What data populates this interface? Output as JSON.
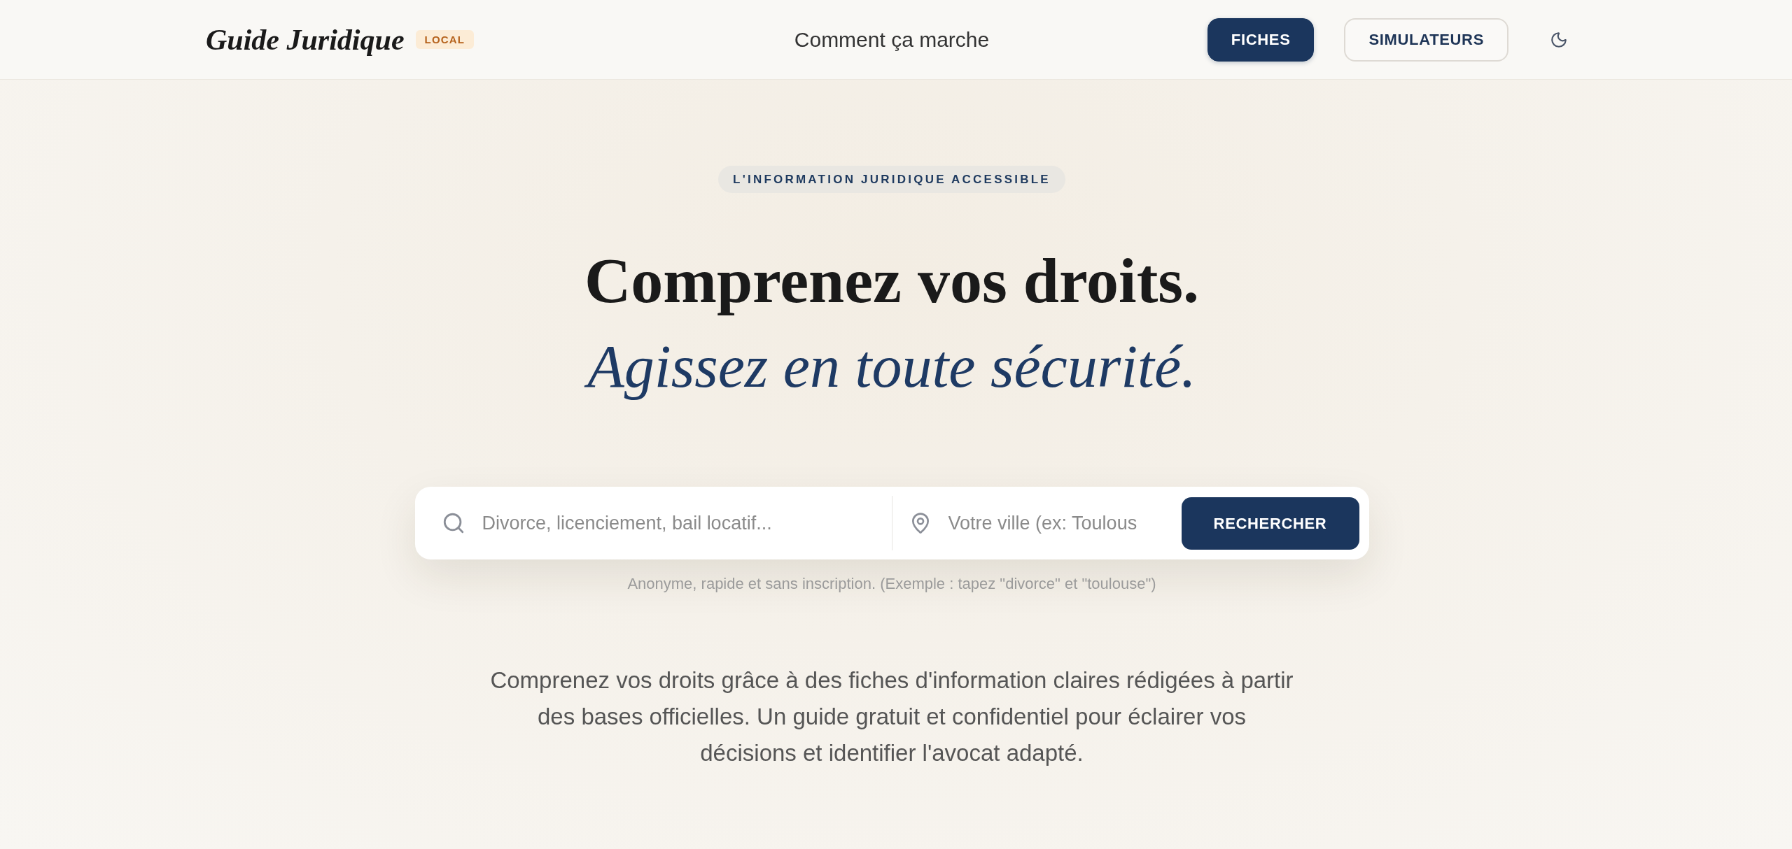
{
  "header": {
    "logo": "Guide Juridique",
    "logo_badge": "LOCAL",
    "nav_link": "Comment ça marche",
    "buttons": [
      {
        "label": "FICHES",
        "kind": "primary"
      },
      {
        "label": "SIMULATEURS",
        "kind": "secondary"
      }
    ]
  },
  "hero": {
    "eyebrow": "L'INFORMATION JURIDIQUE ACCESSIBLE",
    "title": "Comprenez vos droits.",
    "subtitle": "Agissez en toute sécurité."
  },
  "search": {
    "fields": [
      {
        "kind": "query",
        "placeholder": "Divorce, licenciement, bail locatif..."
      },
      {
        "kind": "location",
        "placeholder": "Votre ville (ex: Toulous"
      }
    ],
    "button": "RECHERCHER",
    "hint": "Anonyme, rapide et sans inscription. (Exemple : tapez \"divorce\" et \"toulouse\")"
  },
  "intro": "Comprenez vos droits grâce à des fiches d'information claires rédigées à partir des bases officielles. Un guide gratuit et confidentiel pour éclairer vos décisions et identifier l'avocat adapté."
}
